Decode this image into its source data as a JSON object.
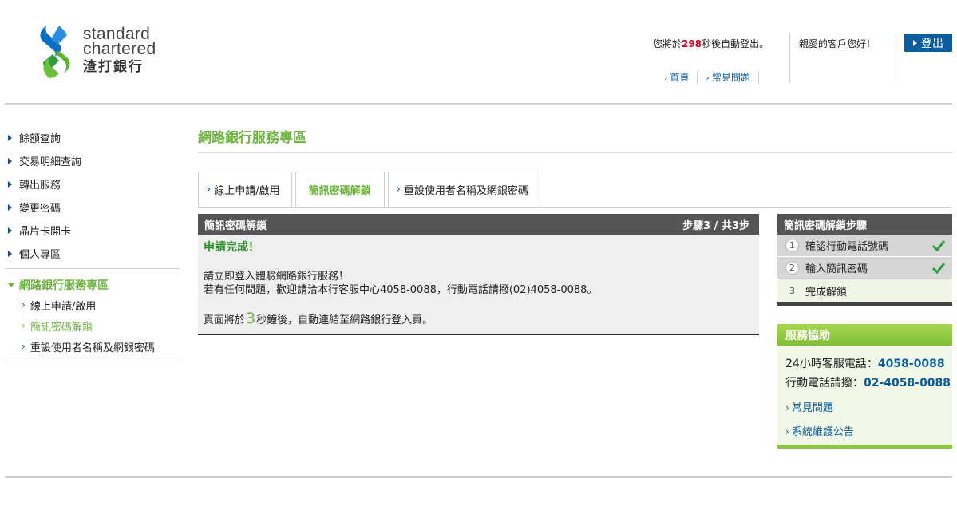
{
  "brand": {
    "name_line1": "standard",
    "name_line2": "chartered",
    "name_zh": "渣打銀行",
    "colors": {
      "blue": "#0b5d9d",
      "green": "#6db33f"
    }
  },
  "header": {
    "session_prefix": "您將於",
    "session_seconds": "298",
    "session_suffix": "秒後自動登出。",
    "greeting": "親愛的客戶您好！",
    "logout_label": "登出",
    "links": [
      {
        "label": "首頁"
      },
      {
        "label": "常見問題"
      }
    ]
  },
  "sidebar": {
    "items": [
      {
        "label": "餘額查詢"
      },
      {
        "label": "交易明細查詢"
      },
      {
        "label": "轉出服務"
      },
      {
        "label": "變更密碼"
      },
      {
        "label": "晶片卡開卡"
      },
      {
        "label": "個人專區"
      }
    ],
    "section": {
      "label": "網路銀行服務專區",
      "sub_items": [
        {
          "label": "線上申請/啟用"
        },
        {
          "label": "簡訊密碼解鎖"
        },
        {
          "label": "重設使用者名稱及網銀密碼"
        }
      ]
    }
  },
  "main": {
    "title": "網路銀行服務專區",
    "tabs": [
      {
        "label": "線上申請/啟用"
      },
      {
        "label": "簡訊密碼解鎖"
      },
      {
        "label": "重設使用者名稱及網銀密碼"
      }
    ],
    "panel": {
      "title": "簡訊密碼解鎖",
      "step_indicator": "步驟3 / 共3步",
      "status": "申請完成！",
      "message_line1": "請立即登入體驗網路銀行服務！",
      "message_line2": "若有任何問題，歡迎請洽本行客服中心4058-0088，行動電話請撥(02)4058-0088。",
      "redirect_prefix": "頁面將於",
      "redirect_seconds": "3",
      "redirect_suffix": "秒鐘後，自動連結至網路銀行登入頁。"
    }
  },
  "steps_box": {
    "title": "簡訊密碼解鎖步驟",
    "steps": [
      {
        "num": "1",
        "label": "確認行動電話號碼",
        "done": true
      },
      {
        "num": "2",
        "label": "輸入簡訊密碼",
        "done": true
      },
      {
        "num": "3",
        "label": "完成解鎖",
        "done": false
      }
    ]
  },
  "service": {
    "title": "服務協助",
    "hotline_label": "24小時客服電話：",
    "hotline_number": "4058-0088",
    "mobile_label": "行動電話請撥：",
    "mobile_number": "02-4058-0088",
    "links": [
      {
        "label": "常見問題"
      },
      {
        "label": "系統維護公告"
      }
    ]
  }
}
